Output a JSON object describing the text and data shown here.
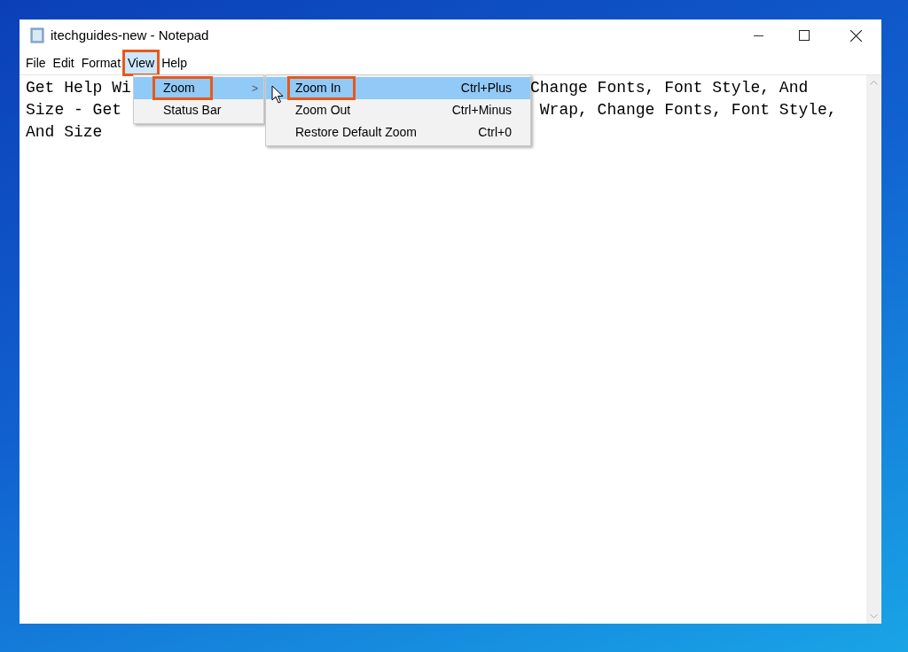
{
  "window": {
    "title": "itechguides-new - Notepad"
  },
  "menu_bar": [
    {
      "label": "File",
      "selected": false,
      "annotated": false
    },
    {
      "label": "Edit",
      "selected": false,
      "annotated": false
    },
    {
      "label": "Format",
      "selected": false,
      "annotated": false
    },
    {
      "label": "View",
      "selected": true,
      "annotated": true
    },
    {
      "label": "Help",
      "selected": false,
      "annotated": false
    }
  ],
  "text_lines": [
    {
      "visible_start": "Get Help Wi",
      "visible_end": "Change Fonts, Font Style, And"
    },
    {
      "visible_start": "Size - Get",
      "visible_end": " Wrap, Change Fonts, Font Style,"
    },
    {
      "visible_start": "And Size"
    }
  ],
  "view_menu": [
    {
      "label": "Zoom",
      "selected": true,
      "has_submenu": true,
      "annotated": true,
      "submenu_arrow": ">"
    },
    {
      "label": "Status Bar",
      "selected": false,
      "has_submenu": false,
      "annotated": false
    }
  ],
  "zoom_submenu": [
    {
      "label": "Zoom In",
      "shortcut": "Ctrl+Plus",
      "selected": true,
      "annotated": true
    },
    {
      "label": "Zoom Out",
      "shortcut": "Ctrl+Minus",
      "selected": false,
      "annotated": false
    },
    {
      "label": "Restore Default Zoom",
      "shortcut": "Ctrl+0",
      "selected": false,
      "annotated": false
    }
  ]
}
